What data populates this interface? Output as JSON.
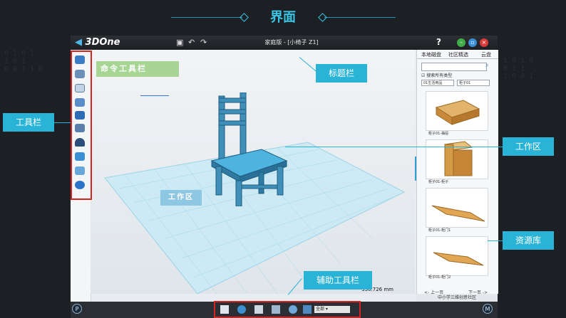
{
  "slide": {
    "title": "界面"
  },
  "app": {
    "logo": "3DOne",
    "doc_title": "家庭版 - [小椅子 Z1]",
    "help_label": "?"
  },
  "workspace": {
    "command_toolbar_label": "命令工具栏",
    "work_area_label": "工作区",
    "distance_readout": "338.726 mm"
  },
  "resource_panel": {
    "tabs": [
      "本地磁盘",
      "社区精选",
      "云盘"
    ],
    "search_placeholder": "",
    "search_all_types": "搜索所有类型",
    "filter_category": "01生活用品",
    "filter_item": "柜子01",
    "items": [
      {
        "caption": "柜子01-抽屉"
      },
      {
        "caption": "柜子01-柜子"
      },
      {
        "caption": "柜子01-柜门1"
      },
      {
        "caption": "柜子01-柜门2"
      }
    ],
    "prev_page": "<- 上一页",
    "next_page": "下一页 ->",
    "community_label": "中小学三维创意社区"
  },
  "bottom_toolbar": {
    "filter_value": "全部",
    "left_button": "P",
    "right_button": "M"
  },
  "callouts": {
    "toolbar": "工具栏",
    "titlebar": "标题栏",
    "workspace": "工作区",
    "library": "资源库",
    "aux_toolbar": "辅助工具栏"
  },
  "colors": {
    "accent": "#29b3d6",
    "highlight_box": "#d42525",
    "chair": "#3f8fb8",
    "cabinet": "#d49a45"
  }
}
